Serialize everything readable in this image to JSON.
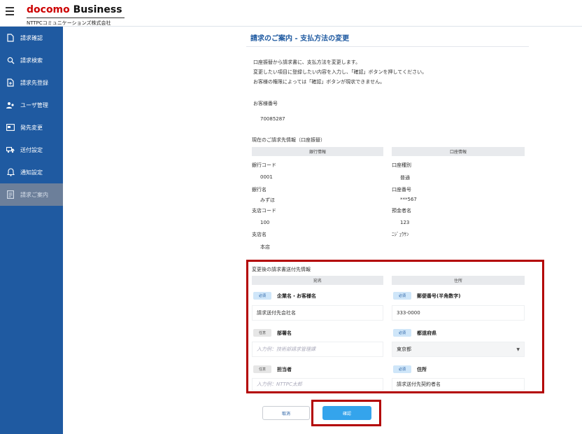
{
  "header": {
    "logo_docomo": "docomo",
    "logo_business": "Business",
    "logo_sub": "NTTPCコミュニケーションズ株式会社"
  },
  "sidebar": {
    "items": [
      {
        "label": "請求確認",
        "icon": "document-icon"
      },
      {
        "label": "請求検索",
        "icon": "search-icon"
      },
      {
        "label": "請求先登録",
        "icon": "document-add-icon"
      },
      {
        "label": "ユーザ管理",
        "icon": "users-icon"
      },
      {
        "label": "発先変更",
        "icon": "card-icon"
      },
      {
        "label": "送付設定",
        "icon": "truck-icon"
      },
      {
        "label": "通知設定",
        "icon": "bell-icon"
      },
      {
        "label": "請求ご案内",
        "icon": "list-icon"
      }
    ]
  },
  "page": {
    "title": "請求のご案内 - 支払方法の変更",
    "intro": [
      "口座振替から請求書に、支払方法を変更します。",
      "変更したい項目に登録したい内容を入力し、「確認」ボタンを押してください。",
      "お客様の権限によっては「確認」ボタンが現状できません。"
    ],
    "customer_no_label": "お客様番号",
    "customer_no": "70085287"
  },
  "current": {
    "section_label": "現在のご請求先情報（口座振替）",
    "left_head": "銀行情報",
    "right_head": "口座情報",
    "bank_code_label": "銀行コード",
    "bank_code": "0001",
    "bank_name_label": "銀行名",
    "bank_name": "みずほ",
    "branch_code_label": "支店コード",
    "branch_code": "100",
    "branch_name_label": "支店名",
    "branch_name": "本店",
    "account_type_label": "口座種別",
    "account_type": "普通",
    "account_no_label": "口座番号",
    "account_no": "***567",
    "holder_label": "預金者名",
    "holder": "123",
    "holder_kana": "ﾆｼﾞｭｳｻﾝ"
  },
  "new_info": {
    "section_label": "変更後の請求書送付先情報",
    "left_head": "宛名",
    "right_head": "住所",
    "required": "必須",
    "optional": "任意",
    "company_label": "企業名・お客様名",
    "company_value": "請求送付先会社名",
    "postal_label": "郵便番号(半角数字)",
    "postal_value": "333-0000",
    "dept_label": "部署名",
    "dept_placeholder": "入力例：技術部請求管理課",
    "prefecture_label": "都道府県",
    "prefecture_value": "東京都",
    "person_label": "担当者",
    "person_placeholder": "入力例：NTTPC太郎",
    "address_label": "住所",
    "address_value": "請求送付先契約者名"
  },
  "buttons": {
    "cancel": "取消",
    "confirm": "確認"
  },
  "colors": {
    "brand_blue": "#1f5aa1",
    "confirm_blue": "#34a4ec",
    "highlight_red": "#b30000"
  }
}
